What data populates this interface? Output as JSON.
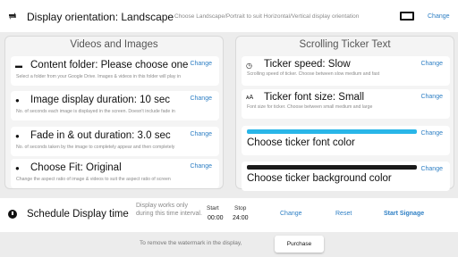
{
  "header": {
    "icon": "rotate-icon",
    "title": "Display orientation: Landscape",
    "hint": "Choose Landscape/Portrait to suit Horizontal/Vertical display orientation",
    "change_label": "Change"
  },
  "videos_panel": {
    "title": "Videos and Images",
    "items": [
      {
        "icon": "folder-icon",
        "label": "Content folder: Please choose one",
        "desc": "Select a folder from your Google Drive. Images & videos in this folder will play in",
        "change_label": "Change"
      },
      {
        "icon": "clock-icon",
        "label": "Image display duration: 10 sec",
        "desc": "No. of seconds each image is displayed in the screen. Doesn't include fade in",
        "change_label": "Change"
      },
      {
        "icon": "clock-icon",
        "label": "Fade in & out duration: 3.0 sec",
        "desc": "No. of seconds taken by the image to completely appear and then completely",
        "change_label": "Change"
      },
      {
        "icon": "clock-icon",
        "label": "Choose Fit: Original",
        "desc": "Change the aspect ratio of image & videos to suit the aspect ratio of screen",
        "change_label": "Change"
      }
    ]
  },
  "ticker_panel": {
    "title": "Scrolling Ticker Text",
    "items": [
      {
        "icon": "speed-icon",
        "label": "Ticker speed: Slow",
        "desc": "Scrolling speed of ticker. Choose between slow medium and fast",
        "change_label": "Change"
      },
      {
        "icon": "font-size-icon",
        "label": "Ticker font size: Small",
        "desc": "Font size for ticker. Choose between small medium and large",
        "change_label": "Change"
      }
    ],
    "font_color": {
      "label": "Choose ticker font color",
      "change_label": "Change",
      "color": "#29b6e8"
    },
    "bg_color": {
      "label": "Choose ticker background color",
      "change_label": "Change",
      "color": "#1a1a1a"
    }
  },
  "schedule": {
    "label": "Schedule Display time",
    "note": "Display works only during this time interval.",
    "start_header": "Start",
    "start_value": "00:00",
    "stop_header": "Stop",
    "stop_value": "24:00",
    "change_label": "Change",
    "reset_label": "Reset",
    "start_signage_label": "Start Signage"
  },
  "footer": {
    "note": "To remove the watermark in the display,",
    "purchase_label": "Purchase"
  },
  "colors": {
    "link": "#2e7fc4",
    "background": "#ececec"
  }
}
